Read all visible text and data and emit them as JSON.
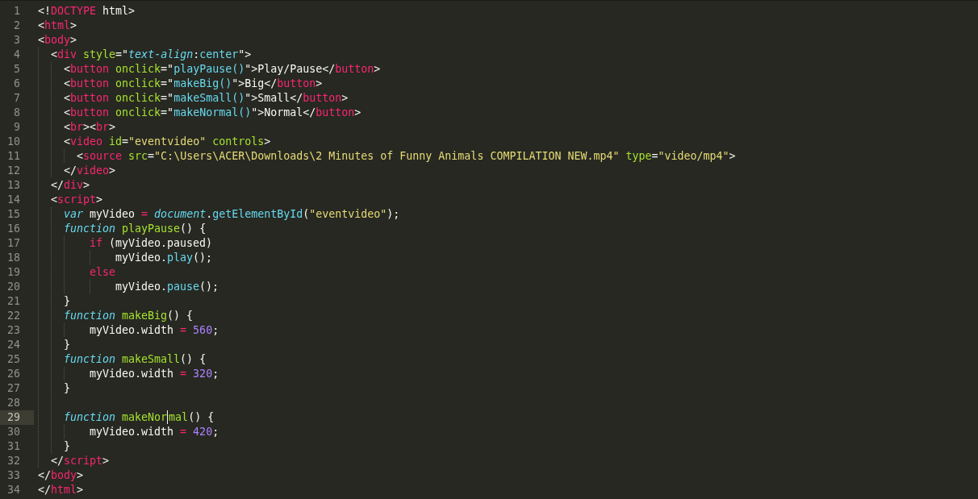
{
  "lines": [
    {
      "number": "1",
      "selected": false,
      "tokens": [
        {
          "kind": "punct",
          "text": "<!"
        },
        {
          "kind": "tag",
          "text": "DOCTYPE"
        },
        {
          "kind": "plain",
          "text": " html>"
        }
      ]
    },
    {
      "number": "2",
      "selected": false,
      "tokens": [
        {
          "kind": "punct",
          "text": "<"
        },
        {
          "kind": "tag",
          "text": "html"
        },
        {
          "kind": "punct",
          "text": ">"
        }
      ]
    },
    {
      "number": "3",
      "selected": false,
      "tokens": [
        {
          "kind": "punct",
          "text": "<"
        },
        {
          "kind": "tag",
          "text": "body"
        },
        {
          "kind": "punct",
          "text": ">"
        }
      ]
    },
    {
      "number": "4",
      "selected": false,
      "guides": [
        {
          "kind": "narrow"
        }
      ],
      "tokens": [
        {
          "kind": "punct",
          "text": "<"
        },
        {
          "kind": "tag",
          "text": "div"
        },
        {
          "kind": "attr",
          "text": " style"
        },
        {
          "kind": "punct",
          "text": "=\""
        },
        {
          "kind": "storage",
          "text": "text-align"
        },
        {
          "kind": "punct",
          "text": ":"
        },
        {
          "kind": "support",
          "text": "center"
        },
        {
          "kind": "punct",
          "text": "\">"
        }
      ]
    },
    {
      "number": "5",
      "selected": false,
      "guides": [
        {
          "kind": "narrow"
        },
        {
          "kind": "narrow"
        }
      ],
      "tokens": [
        {
          "kind": "punct",
          "text": "<"
        },
        {
          "kind": "tag",
          "text": "button"
        },
        {
          "kind": "attr",
          "text": " onclick"
        },
        {
          "kind": "punct",
          "text": "=\""
        },
        {
          "kind": "support",
          "text": "playPause()"
        },
        {
          "kind": "punct",
          "text": "\">Play/Pause</"
        },
        {
          "kind": "tag",
          "text": "button"
        },
        {
          "kind": "punct",
          "text": ">"
        }
      ]
    },
    {
      "number": "6",
      "selected": false,
      "guides": [
        {
          "kind": "narrow"
        },
        {
          "kind": "narrow"
        }
      ],
      "tokens": [
        {
          "kind": "punct",
          "text": "<"
        },
        {
          "kind": "tag",
          "text": "button"
        },
        {
          "kind": "attr",
          "text": " onclick"
        },
        {
          "kind": "punct",
          "text": "=\""
        },
        {
          "kind": "support",
          "text": "makeBig()"
        },
        {
          "kind": "punct",
          "text": "\">Big</"
        },
        {
          "kind": "tag",
          "text": "button"
        },
        {
          "kind": "punct",
          "text": ">"
        }
      ]
    },
    {
      "number": "7",
      "selected": false,
      "guides": [
        {
          "kind": "narrow"
        },
        {
          "kind": "narrow"
        }
      ],
      "tokens": [
        {
          "kind": "punct",
          "text": "<"
        },
        {
          "kind": "tag",
          "text": "button"
        },
        {
          "kind": "attr",
          "text": " onclick"
        },
        {
          "kind": "punct",
          "text": "=\""
        },
        {
          "kind": "support",
          "text": "makeSmall()"
        },
        {
          "kind": "punct",
          "text": "\">Small</"
        },
        {
          "kind": "tag",
          "text": "button"
        },
        {
          "kind": "punct",
          "text": ">"
        }
      ]
    },
    {
      "number": "8",
      "selected": false,
      "guides": [
        {
          "kind": "narrow"
        },
        {
          "kind": "narrow"
        }
      ],
      "tokens": [
        {
          "kind": "punct",
          "text": "<"
        },
        {
          "kind": "tag",
          "text": "button"
        },
        {
          "kind": "attr",
          "text": " onclick"
        },
        {
          "kind": "punct",
          "text": "=\""
        },
        {
          "kind": "support",
          "text": "makeNormal()"
        },
        {
          "kind": "punct",
          "text": "\">Normal</"
        },
        {
          "kind": "tag",
          "text": "button"
        },
        {
          "kind": "punct",
          "text": ">"
        }
      ]
    },
    {
      "number": "9",
      "selected": false,
      "guides": [
        {
          "kind": "narrow"
        },
        {
          "kind": "narrow"
        }
      ],
      "tokens": [
        {
          "kind": "punct",
          "text": "<"
        },
        {
          "kind": "tag",
          "text": "br"
        },
        {
          "kind": "punct",
          "text": "><"
        },
        {
          "kind": "tag",
          "text": "br"
        },
        {
          "kind": "punct",
          "text": ">"
        }
      ]
    },
    {
      "number": "10",
      "selected": false,
      "guides": [
        {
          "kind": "narrow"
        },
        {
          "kind": "narrow"
        }
      ],
      "tokens": [
        {
          "kind": "punct",
          "text": "<"
        },
        {
          "kind": "tag",
          "text": "video"
        },
        {
          "kind": "attr",
          "text": " id"
        },
        {
          "kind": "punct",
          "text": "="
        },
        {
          "kind": "string",
          "text": "\"eventvideo\""
        },
        {
          "kind": "attr",
          "text": " controls"
        },
        {
          "kind": "punct",
          "text": ">"
        }
      ]
    },
    {
      "number": "11",
      "selected": false,
      "guides": [
        {
          "kind": "narrow"
        },
        {
          "kind": "narrow"
        },
        {
          "kind": "narrow"
        }
      ],
      "tokens": [
        {
          "kind": "punct",
          "text": "<"
        },
        {
          "kind": "tag",
          "text": "source"
        },
        {
          "kind": "attr",
          "text": " src"
        },
        {
          "kind": "punct",
          "text": "="
        },
        {
          "kind": "string",
          "text": "\"C:\\Users\\ACER\\Downloads\\2 Minutes of Funny Animals COMPILATION NEW.mp4\""
        },
        {
          "kind": "attr",
          "text": " type"
        },
        {
          "kind": "punct",
          "text": "="
        },
        {
          "kind": "string",
          "text": "\"video/mp4\""
        },
        {
          "kind": "punct",
          "text": ">"
        }
      ]
    },
    {
      "number": "12",
      "selected": false,
      "guides": [
        {
          "kind": "narrow"
        },
        {
          "kind": "narrow"
        }
      ],
      "tokens": [
        {
          "kind": "punct",
          "text": "</"
        },
        {
          "kind": "tag",
          "text": "video"
        },
        {
          "kind": "punct",
          "text": ">"
        }
      ]
    },
    {
      "number": "13",
      "selected": false,
      "guides": [
        {
          "kind": "narrow"
        }
      ],
      "tokens": [
        {
          "kind": "punct",
          "text": "</"
        },
        {
          "kind": "tag",
          "text": "div"
        },
        {
          "kind": "punct",
          "text": ">"
        }
      ]
    },
    {
      "number": "14",
      "selected": false,
      "guides": [
        {
          "kind": "narrow"
        }
      ],
      "tokens": [
        {
          "kind": "punct",
          "text": "<"
        },
        {
          "kind": "tag",
          "text": "script"
        },
        {
          "kind": "punct",
          "text": ">"
        }
      ]
    },
    {
      "number": "15",
      "selected": false,
      "guides": [
        {
          "kind": "narrow"
        },
        {
          "kind": "narrow"
        }
      ],
      "tokens": [
        {
          "kind": "storage",
          "text": "var"
        },
        {
          "kind": "plain",
          "text": " myVideo "
        },
        {
          "kind": "operator",
          "text": "="
        },
        {
          "kind": "storage",
          "text": " document"
        },
        {
          "kind": "plain",
          "text": "."
        },
        {
          "kind": "support",
          "text": "getElementById"
        },
        {
          "kind": "punct",
          "text": "("
        },
        {
          "kind": "string",
          "text": "\"eventvideo\""
        },
        {
          "kind": "punct",
          "text": ");"
        }
      ]
    },
    {
      "number": "16",
      "selected": false,
      "guides": [
        {
          "kind": "narrow"
        },
        {
          "kind": "narrow"
        }
      ],
      "tokens": [
        {
          "kind": "storage",
          "text": "function"
        },
        {
          "kind": "function",
          "text": " playPause"
        },
        {
          "kind": "punct",
          "text": "() {"
        }
      ]
    },
    {
      "number": "17",
      "selected": false,
      "guides": [
        {
          "kind": "narrow"
        },
        {
          "kind": "narrow"
        },
        {
          "kind": "wide"
        }
      ],
      "tokens": [
        {
          "kind": "operator",
          "text": "if"
        },
        {
          "kind": "plain",
          "text": " (myVideo.paused)"
        }
      ]
    },
    {
      "number": "18",
      "selected": false,
      "guides": [
        {
          "kind": "narrow"
        },
        {
          "kind": "narrow"
        },
        {
          "kind": "wide"
        },
        {
          "kind": "wide"
        }
      ],
      "tokens": [
        {
          "kind": "plain",
          "text": "myVideo."
        },
        {
          "kind": "support",
          "text": "play"
        },
        {
          "kind": "punct",
          "text": "();"
        }
      ]
    },
    {
      "number": "19",
      "selected": false,
      "guides": [
        {
          "kind": "narrow"
        },
        {
          "kind": "narrow"
        },
        {
          "kind": "wide"
        }
      ],
      "tokens": [
        {
          "kind": "operator",
          "text": "else"
        }
      ]
    },
    {
      "number": "20",
      "selected": false,
      "guides": [
        {
          "kind": "narrow"
        },
        {
          "kind": "narrow"
        },
        {
          "kind": "wide"
        },
        {
          "kind": "wide"
        }
      ],
      "tokens": [
        {
          "kind": "plain",
          "text": "myVideo."
        },
        {
          "kind": "support",
          "text": "pause"
        },
        {
          "kind": "punct",
          "text": "();"
        }
      ]
    },
    {
      "number": "21",
      "selected": false,
      "guides": [
        {
          "kind": "narrow"
        },
        {
          "kind": "narrow"
        }
      ],
      "tokens": [
        {
          "kind": "punct",
          "text": "}"
        }
      ]
    },
    {
      "number": "22",
      "selected": false,
      "guides": [
        {
          "kind": "narrow"
        },
        {
          "kind": "narrow"
        }
      ],
      "tokens": [
        {
          "kind": "storage",
          "text": "function"
        },
        {
          "kind": "function",
          "text": " makeBig"
        },
        {
          "kind": "punct",
          "text": "() {"
        }
      ]
    },
    {
      "number": "23",
      "selected": false,
      "guides": [
        {
          "kind": "narrow"
        },
        {
          "kind": "narrow"
        },
        {
          "kind": "wide"
        }
      ],
      "tokens": [
        {
          "kind": "plain",
          "text": "myVideo.width "
        },
        {
          "kind": "operator",
          "text": "="
        },
        {
          "kind": "number",
          "text": " 560"
        },
        {
          "kind": "punct",
          "text": ";"
        }
      ]
    },
    {
      "number": "24",
      "selected": false,
      "guides": [
        {
          "kind": "narrow"
        },
        {
          "kind": "narrow"
        }
      ],
      "tokens": [
        {
          "kind": "punct",
          "text": "}"
        }
      ]
    },
    {
      "number": "25",
      "selected": false,
      "guides": [
        {
          "kind": "narrow"
        },
        {
          "kind": "narrow"
        }
      ],
      "tokens": [
        {
          "kind": "storage",
          "text": "function"
        },
        {
          "kind": "function",
          "text": " makeSmall"
        },
        {
          "kind": "punct",
          "text": "() {"
        }
      ]
    },
    {
      "number": "26",
      "selected": false,
      "guides": [
        {
          "kind": "narrow"
        },
        {
          "kind": "narrow"
        },
        {
          "kind": "wide"
        }
      ],
      "tokens": [
        {
          "kind": "plain",
          "text": "myVideo.width "
        },
        {
          "kind": "operator",
          "text": "="
        },
        {
          "kind": "number",
          "text": " 320"
        },
        {
          "kind": "punct",
          "text": ";"
        }
      ]
    },
    {
      "number": "27",
      "selected": false,
      "guides": [
        {
          "kind": "narrow"
        },
        {
          "kind": "narrow"
        }
      ],
      "tokens": [
        {
          "kind": "punct",
          "text": "}"
        }
      ]
    },
    {
      "number": "28",
      "selected": false,
      "guides": [
        {
          "kind": "narrow"
        },
        {
          "kind": "narrow"
        }
      ]
    },
    {
      "number": "29",
      "selected": true,
      "guides": [
        {
          "kind": "narrow"
        },
        {
          "kind": "narrow"
        }
      ],
      "tokens": [
        {
          "kind": "storage",
          "text": "function"
        },
        {
          "kind": "function",
          "text": " makeNor"
        },
        {
          "kind": "function",
          "text": "mal",
          "caret": true
        },
        {
          "kind": "punct",
          "text": "() {"
        }
      ]
    },
    {
      "number": "30",
      "selected": false,
      "guides": [
        {
          "kind": "narrow"
        },
        {
          "kind": "narrow"
        },
        {
          "kind": "wide"
        }
      ],
      "tokens": [
        {
          "kind": "plain",
          "text": "myVideo.width "
        },
        {
          "kind": "operator",
          "text": "="
        },
        {
          "kind": "number",
          "text": " 420"
        },
        {
          "kind": "punct",
          "text": ";"
        }
      ]
    },
    {
      "number": "31",
      "selected": false,
      "guides": [
        {
          "kind": "narrow"
        },
        {
          "kind": "narrow"
        }
      ],
      "tokens": [
        {
          "kind": "punct",
          "text": "}"
        }
      ]
    },
    {
      "number": "32",
      "selected": false,
      "guides": [
        {
          "kind": "narrow"
        }
      ],
      "tokens": [
        {
          "kind": "punct",
          "text": "</"
        },
        {
          "kind": "tag",
          "text": "script"
        },
        {
          "kind": "punct",
          "text": ">"
        }
      ]
    },
    {
      "number": "33",
      "selected": false,
      "tokens": [
        {
          "kind": "punct",
          "text": "</"
        },
        {
          "kind": "tag",
          "text": "body"
        },
        {
          "kind": "punct",
          "text": ">"
        }
      ]
    },
    {
      "number": "34",
      "selected": false,
      "tokens": [
        {
          "kind": "punct",
          "text": "</"
        },
        {
          "kind": "tag",
          "text": "html"
        },
        {
          "kind": "punct",
          "text": ">"
        }
      ]
    }
  ]
}
